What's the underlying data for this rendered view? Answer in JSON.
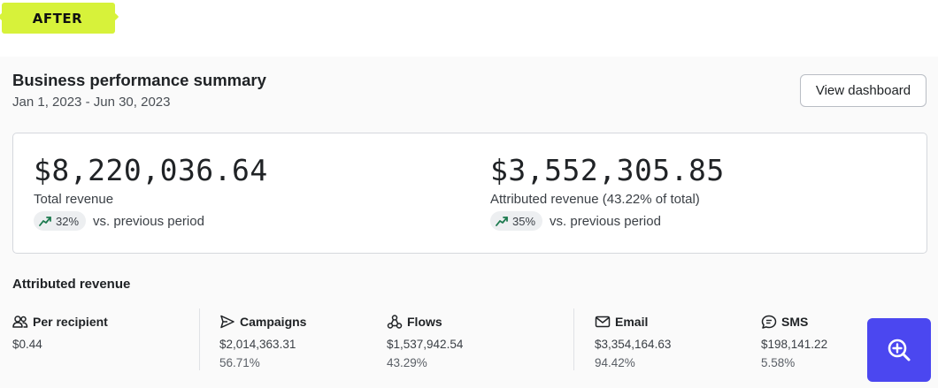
{
  "badge": {
    "label": "AFTER"
  },
  "header": {
    "title": "Business performance summary",
    "date_range": "Jan 1, 2023 - Jun 30, 2023",
    "view_dashboard_label": "View dashboard"
  },
  "summary": [
    {
      "amount": "$8,220,036.64",
      "label": "Total revenue",
      "change": "32%",
      "change_suffix": "vs. previous period"
    },
    {
      "amount": "$3,552,305.85",
      "label": "Attributed revenue (43.22% of total)",
      "change": "35%",
      "change_suffix": "vs. previous period"
    }
  ],
  "attributed": {
    "title": "Attributed revenue",
    "stats": [
      {
        "name": "Per recipient",
        "icon": "people-icon",
        "value": "$0.44",
        "percent": ""
      },
      {
        "name": "Campaigns",
        "icon": "send-icon",
        "value": "$2,014,363.31",
        "percent": "56.71%"
      },
      {
        "name": "Flows",
        "icon": "flows-icon",
        "value": "$1,537,942.54",
        "percent": "43.29%"
      },
      {
        "name": "Email",
        "icon": "mail-icon",
        "value": "$3,354,164.63",
        "percent": "94.42%"
      },
      {
        "name": "SMS",
        "icon": "chat-icon",
        "value": "$198,141.22",
        "percent": "5.58%"
      }
    ]
  },
  "colors": {
    "badge": "#d7f23a",
    "zoom_button": "#4b47f0",
    "trend_up": "#1d7a4f"
  }
}
